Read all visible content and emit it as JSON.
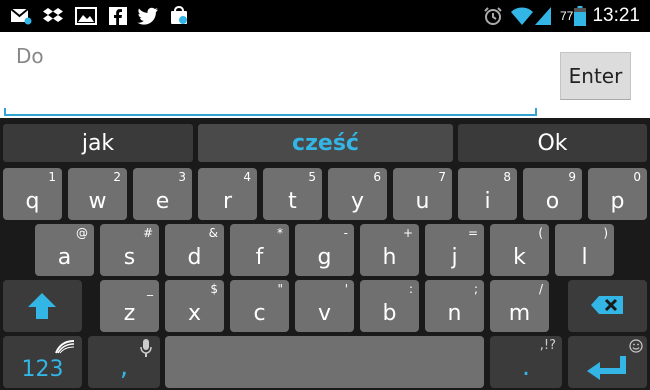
{
  "status": {
    "battery": "77",
    "time": "13:21",
    "icons": [
      "gmail-icon",
      "dropbox-icon",
      "gallery-icon",
      "facebook-icon",
      "twitter-icon",
      "market-icon",
      "alarm-icon",
      "wifi-icon",
      "signal-icon",
      "battery-icon"
    ]
  },
  "input": {
    "value": "Do",
    "enter_label": "Enter"
  },
  "suggestions": [
    "jak",
    "cześć",
    "Ok"
  ],
  "rows": {
    "row1": [
      {
        "k": "q",
        "a": "1"
      },
      {
        "k": "w",
        "a": "2"
      },
      {
        "k": "e",
        "a": "3"
      },
      {
        "k": "r",
        "a": "4"
      },
      {
        "k": "t",
        "a": "5"
      },
      {
        "k": "y",
        "a": "6"
      },
      {
        "k": "u",
        "a": "7"
      },
      {
        "k": "i",
        "a": "8"
      },
      {
        "k": "o",
        "a": "9"
      },
      {
        "k": "p",
        "a": "0"
      }
    ],
    "row2": [
      {
        "k": "a",
        "a": "@"
      },
      {
        "k": "s",
        "a": "#"
      },
      {
        "k": "d",
        "a": "&"
      },
      {
        "k": "f",
        "a": "*"
      },
      {
        "k": "g",
        "a": "-"
      },
      {
        "k": "h",
        "a": "+"
      },
      {
        "k": "j",
        "a": "="
      },
      {
        "k": "k",
        "a": "("
      },
      {
        "k": "l",
        "a": ")"
      }
    ],
    "row3": [
      {
        "k": "z",
        "a": "_"
      },
      {
        "k": "x",
        "a": "$"
      },
      {
        "k": "c",
        "a": "\""
      },
      {
        "k": "v",
        "a": "'"
      },
      {
        "k": "b",
        "a": ":"
      },
      {
        "k": "n",
        "a": ";"
      },
      {
        "k": "m",
        "a": "/"
      }
    ]
  },
  "bottom": {
    "num_label": "123",
    "comma": ",",
    "period": ".",
    "punct_alt": ",!?"
  }
}
